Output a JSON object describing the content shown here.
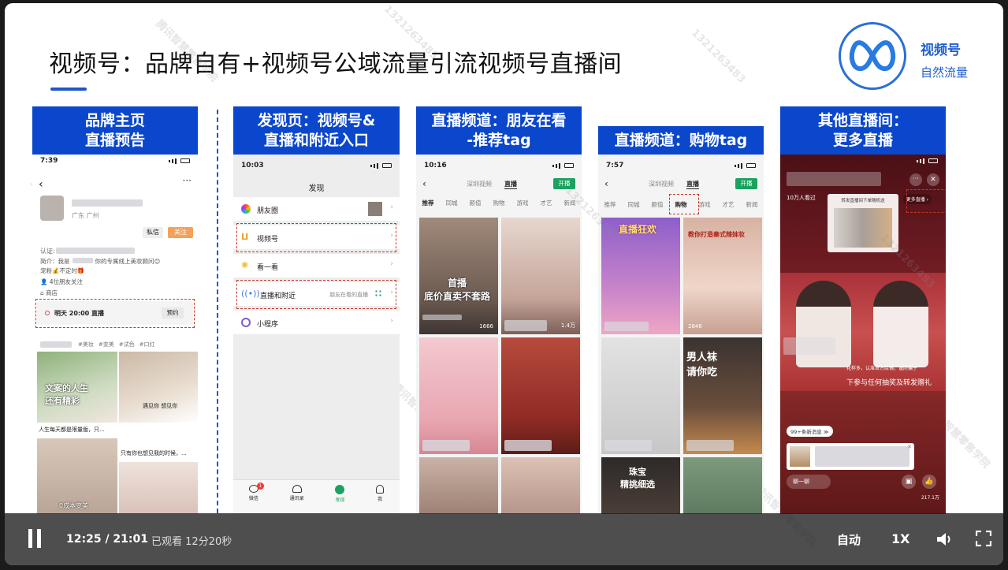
{
  "slide": {
    "title": "视频号：品牌自有+视频号公域流量引流视频号直播间",
    "logo_name": "视频号",
    "logo_sub": "自然流量",
    "watermark_text": "1321263483",
    "watermark_org": "腾讯智慧零售学院"
  },
  "panels": {
    "p1": {
      "header_line1": "品牌主页",
      "header_line2": "直播预告",
      "status_time": "7:39",
      "location": "广东 广州",
      "btn_msg": "私信",
      "btn_follow": "关注",
      "auth_label": "认证:",
      "bio_line1": "简介：我是",
      "bio_line1b": "你的专属线上美妆顾问😊",
      "bio_line2": "宠粉💰不定时🎁",
      "followers": "4位朋友关注",
      "shop": "商店",
      "live_notice": "明天 20:00 直播",
      "reserve": "预约",
      "tags": [
        "#美妆",
        "#变美",
        "#试色",
        "#口红"
      ],
      "v1_overlay": "文案的人生\n还有精彩",
      "v1_caption": "人生每天都是限量版，只...",
      "v2_overlay": "遇见你 想见你",
      "v2_caption": "只有你也想见我的时候，...",
      "v3_overlay": "0成本变美"
    },
    "p2": {
      "header_line1": "发现页：视频号&",
      "header_line2": "直播和附近入口",
      "status_time": "10:03",
      "page_title": "发现",
      "items": [
        "朋友圈",
        "视频号",
        "看一看",
        "直播和附近",
        "小程序"
      ],
      "nearby_hint": "朋友在看的直播",
      "tabbar": [
        "微信",
        "通讯录",
        "发现",
        "我"
      ],
      "badge": "1"
    },
    "p3": {
      "header_line1": "直播频道：朋友在看",
      "header_line2": "-推荐tag",
      "status_time": "10:16",
      "top_tabs": [
        "深圳视频",
        "直播"
      ],
      "start_btn": "开播",
      "cats": [
        "推荐",
        "同城",
        "颜值",
        "购物",
        "游戏",
        "才艺",
        "新闻"
      ],
      "c1_overlay": "首播\n底价直卖不套路",
      "c1_count": "1666",
      "c2_count": "1.4万"
    },
    "p4": {
      "header_line1": "直播频道：购物tag",
      "status_time": "7:57",
      "top_tabs": [
        "深圳视频",
        "直播"
      ],
      "start_btn": "开播",
      "cats": [
        "推荐",
        "同城",
        "颜值",
        "购物",
        "游戏",
        "才艺",
        "新闻"
      ],
      "c1_overlay": "直播狂欢",
      "c2_overlay": "教你打造秦式辣妹妆",
      "c2_count": "2846",
      "c3_overlay": "男人袜\n请你吃",
      "c4_overlay": "珠宝\n精挑细选"
    },
    "p5": {
      "header_line1": "其他直播间：",
      "header_line2": "更多直播",
      "viewers": "10万人看过",
      "product_title": "转发直播间下单随机送",
      "more_live": "更多直播 ›",
      "subtitle1": "花样多，认准官方店铺，谨防骗子",
      "subtitle2": "下参与任何抽奖及转发赠礼",
      "new_msgs": "99+条新消息 ≫",
      "say": "聊一聊",
      "likes": "217.1万"
    }
  },
  "player": {
    "time": "12:25 / 21:01",
    "watched": "已观看 12分20秒",
    "auto": "自动",
    "speed": "1X"
  },
  "colors": {
    "header_blue": "#0b47cc",
    "accent": "#1f5fd0",
    "dash_red": "#c0392b"
  }
}
